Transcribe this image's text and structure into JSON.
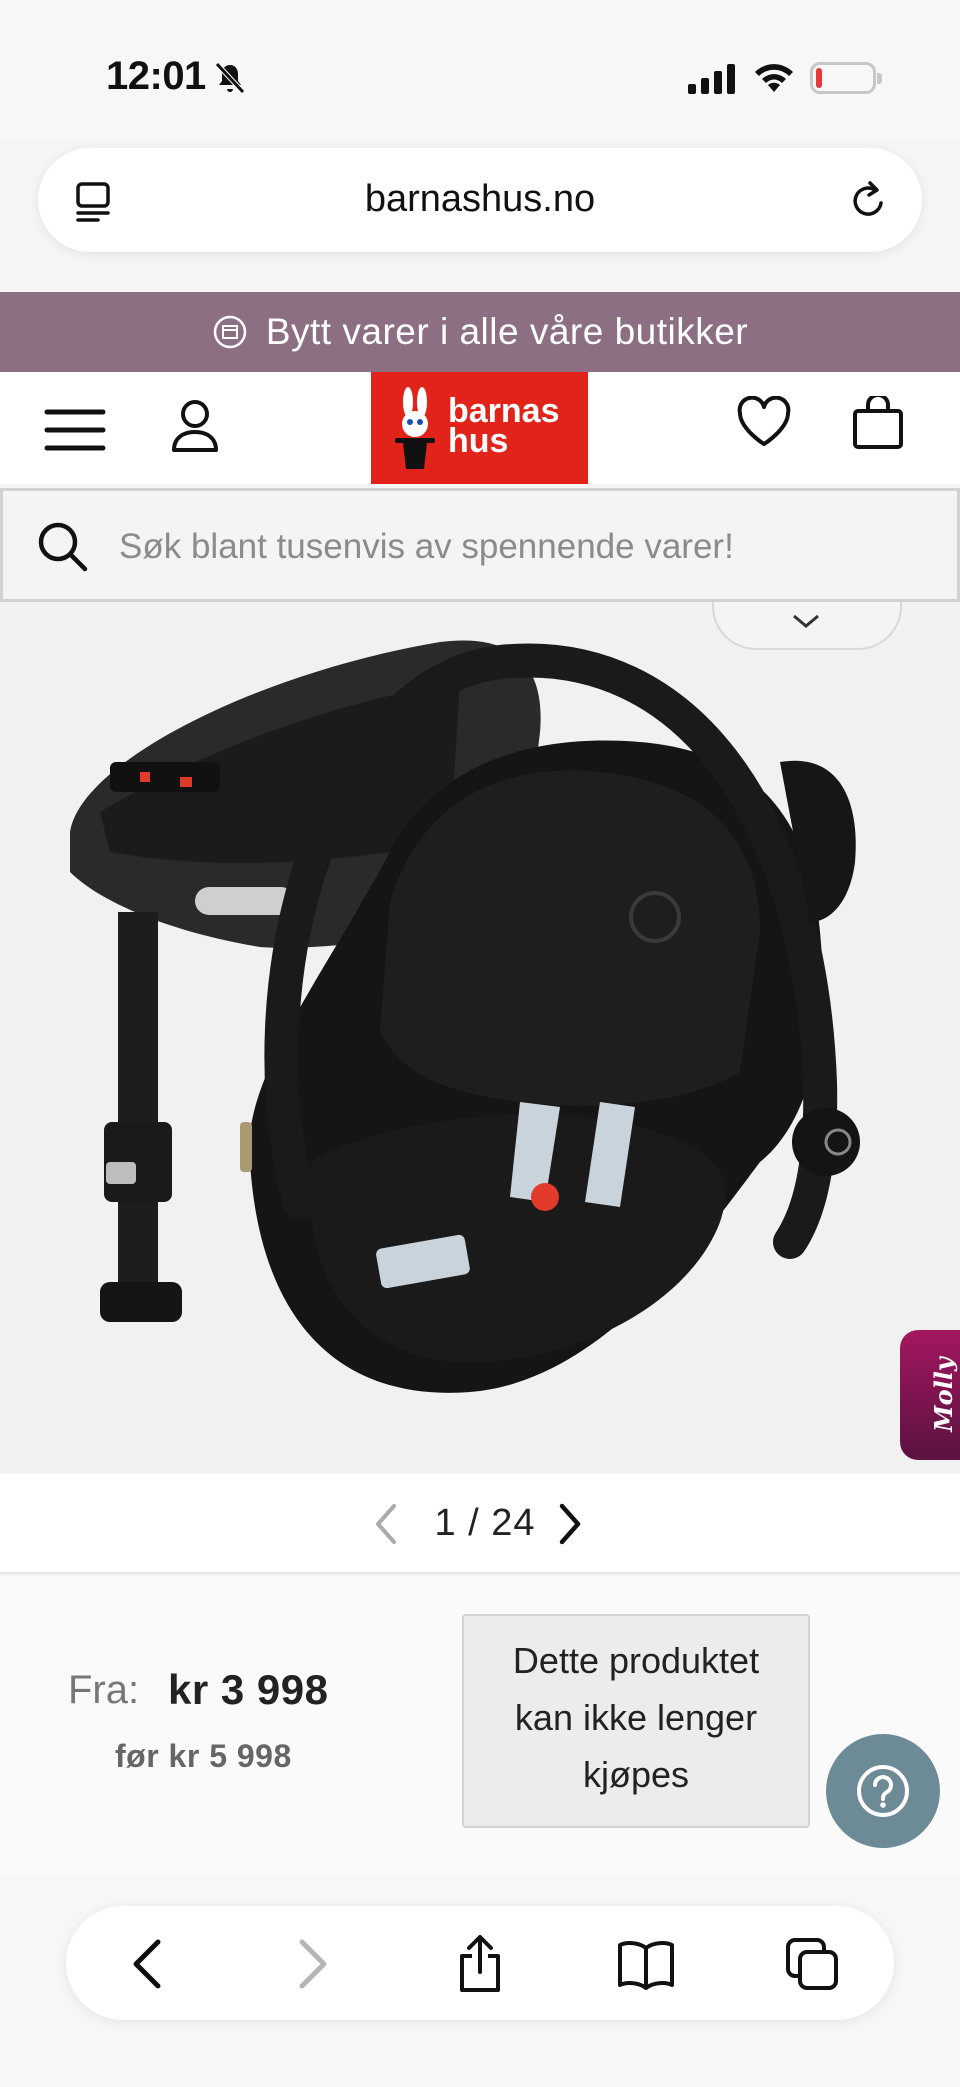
{
  "status_bar": {
    "time": "12:01"
  },
  "browser": {
    "url": "barnashus.no"
  },
  "promo": {
    "text": "Bytt varer i alle våre butikker"
  },
  "header": {
    "logo_line1": "barnas",
    "logo_line2": "hus"
  },
  "search": {
    "placeholder": "Søk blant tusenvis av spennende varer!"
  },
  "product_gallery": {
    "side_tab_label": "Molly",
    "pager_text": "1 / 24"
  },
  "pricing": {
    "from_label": "Fra:",
    "price": "kr 3 998",
    "before_price": "før kr 5 998",
    "unavailable_line1": "Dette produktet",
    "unavailable_line2": "kan ikke lenger",
    "unavailable_line3": "kjøpes"
  },
  "colors": {
    "promo_bg": "#8d6f84",
    "logo_red": "#e1231a",
    "help_button": "#6d8a97",
    "molly_tab": "#a3175f"
  }
}
